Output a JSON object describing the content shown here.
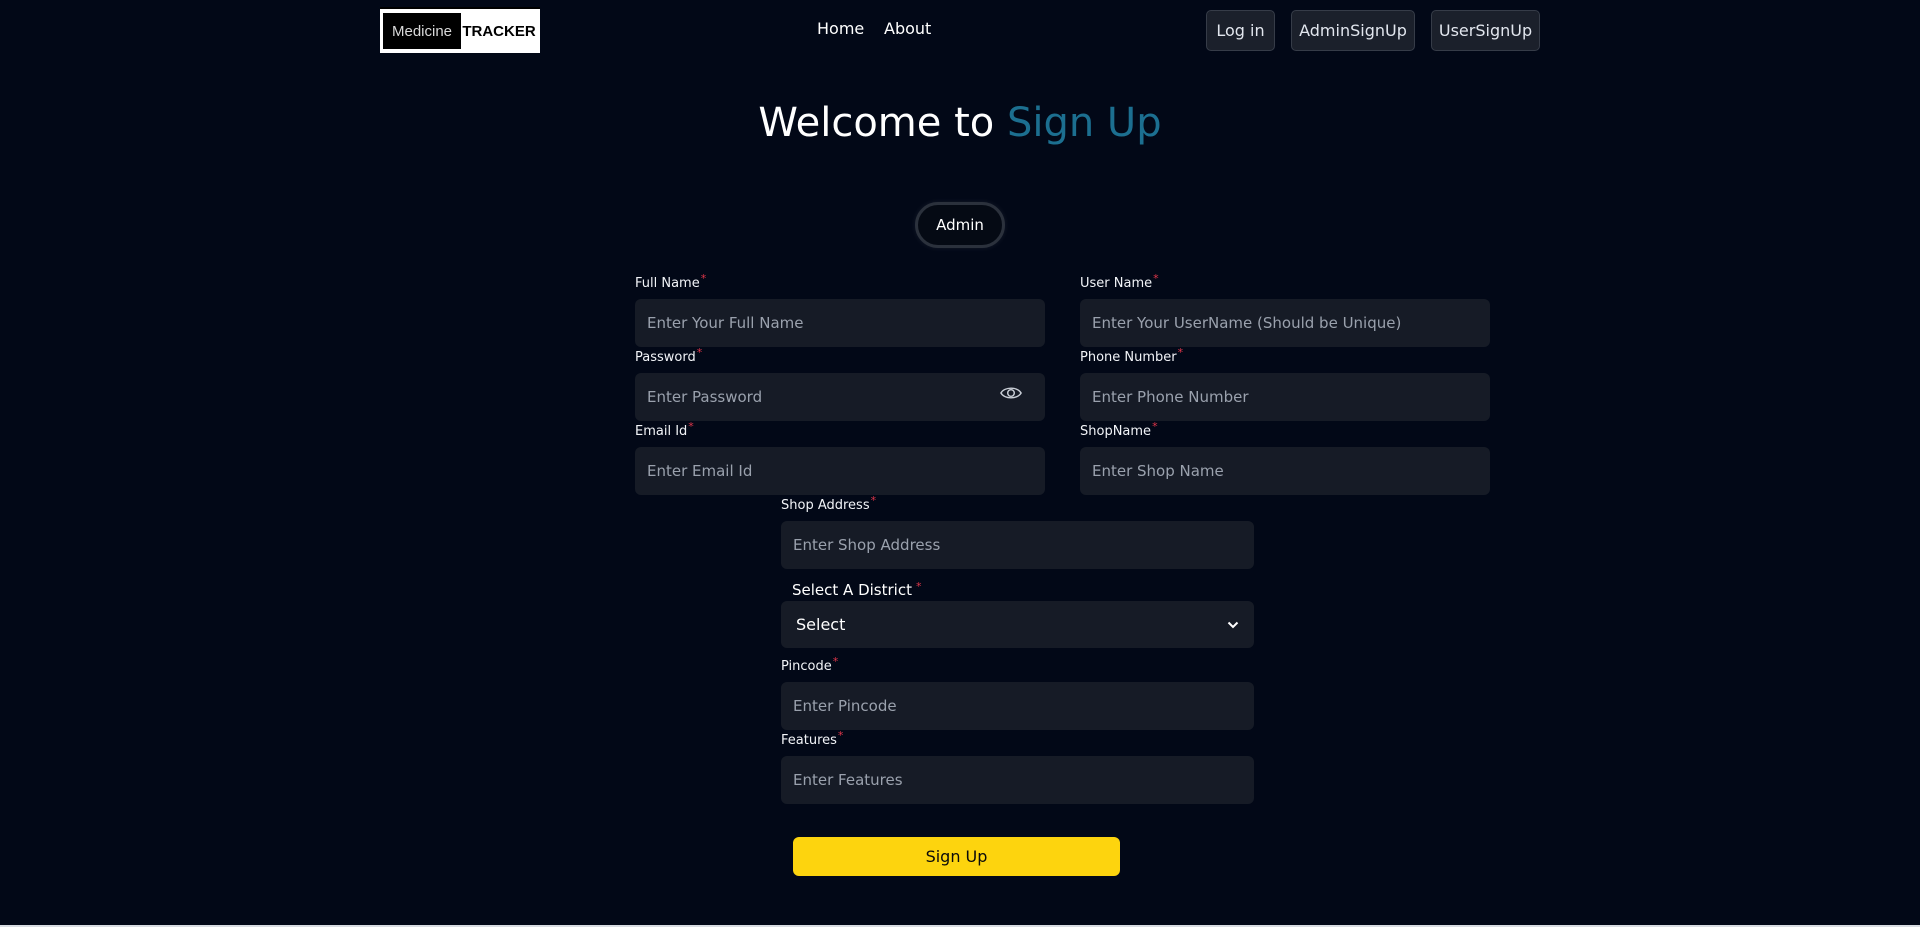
{
  "header": {
    "logo": {
      "left": "Medicine",
      "right": "TRACKER"
    },
    "nav": [
      {
        "label": "Home"
      },
      {
        "label": "About"
      }
    ],
    "buttons": [
      {
        "label": "Log in"
      },
      {
        "label": "AdminSignUp"
      },
      {
        "label": "UserSignUp"
      }
    ]
  },
  "title": {
    "prefix": "Welcome to ",
    "accent": "Sign Up"
  },
  "role_pill": "Admin",
  "form": {
    "full_name": {
      "label": "Full Name",
      "placeholder": "Enter Your Full Name"
    },
    "user_name": {
      "label": "User Name",
      "placeholder": "Enter Your UserName (Should be Unique)"
    },
    "password": {
      "label": "Password",
      "placeholder": "Enter Password"
    },
    "phone": {
      "label": "Phone Number",
      "placeholder": "Enter Phone Number"
    },
    "email": {
      "label": "Email Id",
      "placeholder": "Enter Email Id"
    },
    "shop_name": {
      "label": "ShopName",
      "placeholder": "Enter Shop Name"
    },
    "shop_address": {
      "label": "Shop Address",
      "placeholder": "Enter Shop Address"
    },
    "district": {
      "label": "Select A District",
      "selected": "Select"
    },
    "pincode": {
      "label": "Pincode",
      "placeholder": "Enter Pincode"
    },
    "features": {
      "label": "Features",
      "placeholder": "Enter Features"
    },
    "required_mark": "*",
    "submit": "Sign Up"
  },
  "colors": {
    "background": "#020817",
    "accent": "#1c6f90",
    "field_bg": "#161b26",
    "button": "#fdd40e",
    "required": "#e0364a"
  },
  "icons": {
    "password_toggle": "eye-icon",
    "dropdown": "chevron-down-icon"
  }
}
